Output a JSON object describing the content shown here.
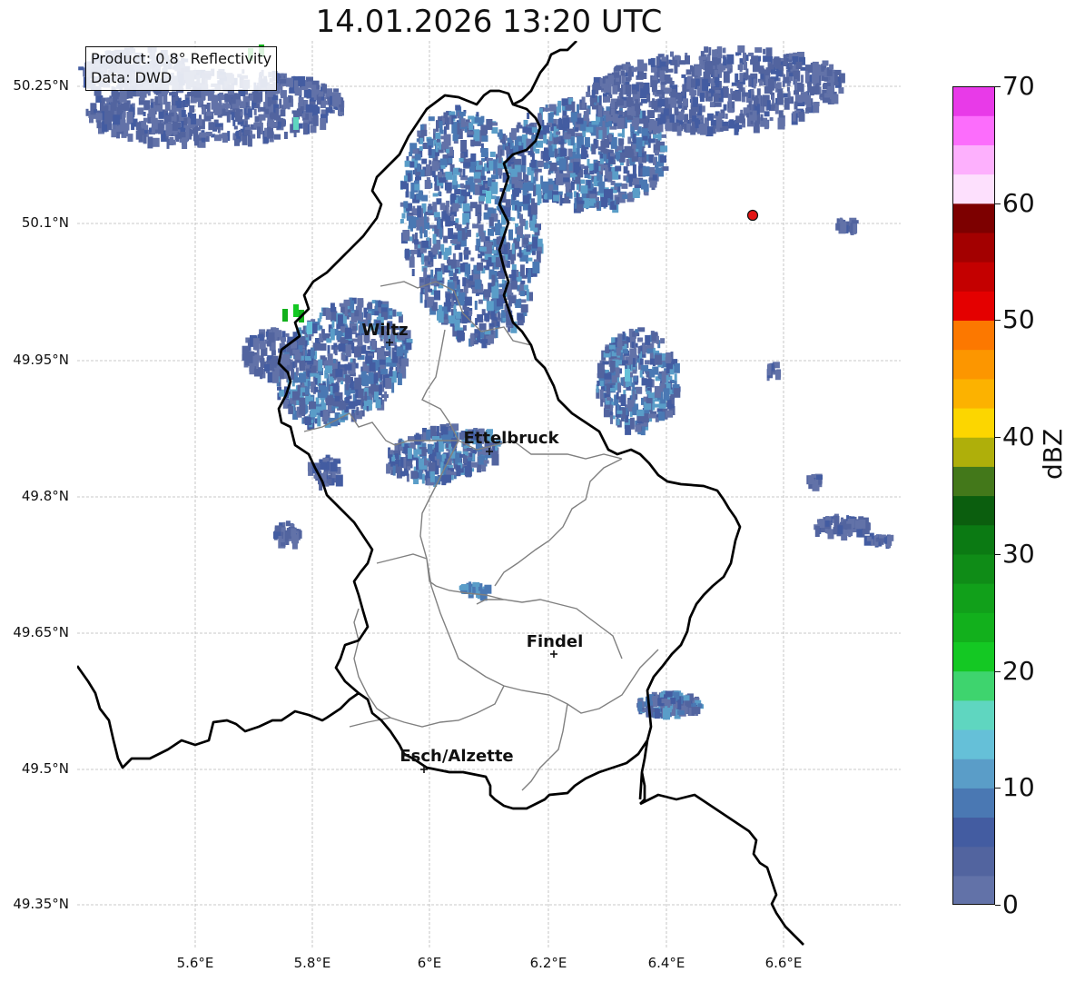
{
  "title": "14.01.2026 13:20 UTC",
  "info": {
    "product": "Product: 0.8° Reflectivity",
    "data_source": "Data: DWD"
  },
  "axes": {
    "lat_labels": [
      "50.25°N",
      "50.1°N",
      "49.95°N",
      "49.8°N",
      "49.65°N",
      "49.5°N",
      "49.35°N"
    ],
    "lon_labels": [
      "5.6°E",
      "5.8°E",
      "6°E",
      "6.2°E",
      "6.4°E",
      "6.6°E"
    ]
  },
  "cities": [
    {
      "name": "Wiltz"
    },
    {
      "name": "Ettelbruck"
    },
    {
      "name": "Findel"
    },
    {
      "name": "Esch/Alzette"
    }
  ],
  "colorbar": {
    "unit": "dBZ",
    "min": 0,
    "max": 70,
    "tick_labels": [
      "0",
      "10",
      "20",
      "30",
      "40",
      "50",
      "60",
      "70"
    ],
    "colors": [
      "#6272a8",
      "#52649f",
      "#435ca1",
      "#4a78b3",
      "#5a9dc8",
      "#65c0d8",
      "#5fd6c0",
      "#3ed46e",
      "#14c823",
      "#12b01c",
      "#11a01a",
      "#0f8c17",
      "#0b7a13",
      "#0b5e0e",
      "#43781a",
      "#afaf0a",
      "#fcd600",
      "#fcb200",
      "#fc9600",
      "#fc7800",
      "#e40000",
      "#c40000",
      "#a30000",
      "#7d0000",
      "#fde0fd",
      "#fdb0fd",
      "#fc6dfc",
      "#e83ae8"
    ]
  },
  "style_colors": {
    "country_border": "#000000",
    "canton_border": "#808080",
    "marker": "#e31313",
    "grid": "#b9b9b9"
  }
}
